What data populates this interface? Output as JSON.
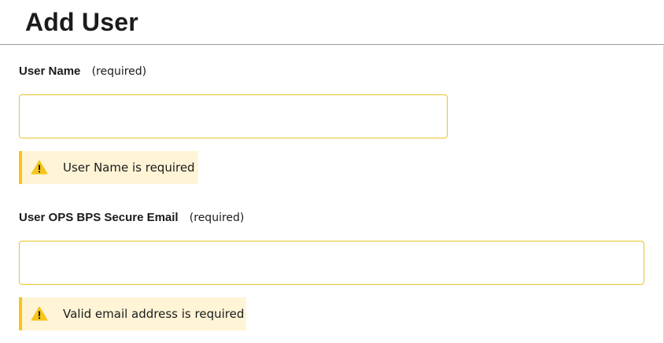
{
  "header": {
    "title": "Add User"
  },
  "form": {
    "user_name": {
      "label": "User Name",
      "required_note": "(required)",
      "value": "",
      "placeholder": "",
      "error": "User Name is required"
    },
    "secure_email": {
      "label": "User OPS BPS Secure Email",
      "required_note": "(required)",
      "value": "",
      "placeholder": "",
      "error": "Valid email address is required"
    }
  },
  "icons": {
    "alert_icon": "warning-icon"
  },
  "colors": {
    "input_border": "#e8c32b",
    "alert_background": "#fff4d6",
    "alert_bar": "#f5c518"
  }
}
